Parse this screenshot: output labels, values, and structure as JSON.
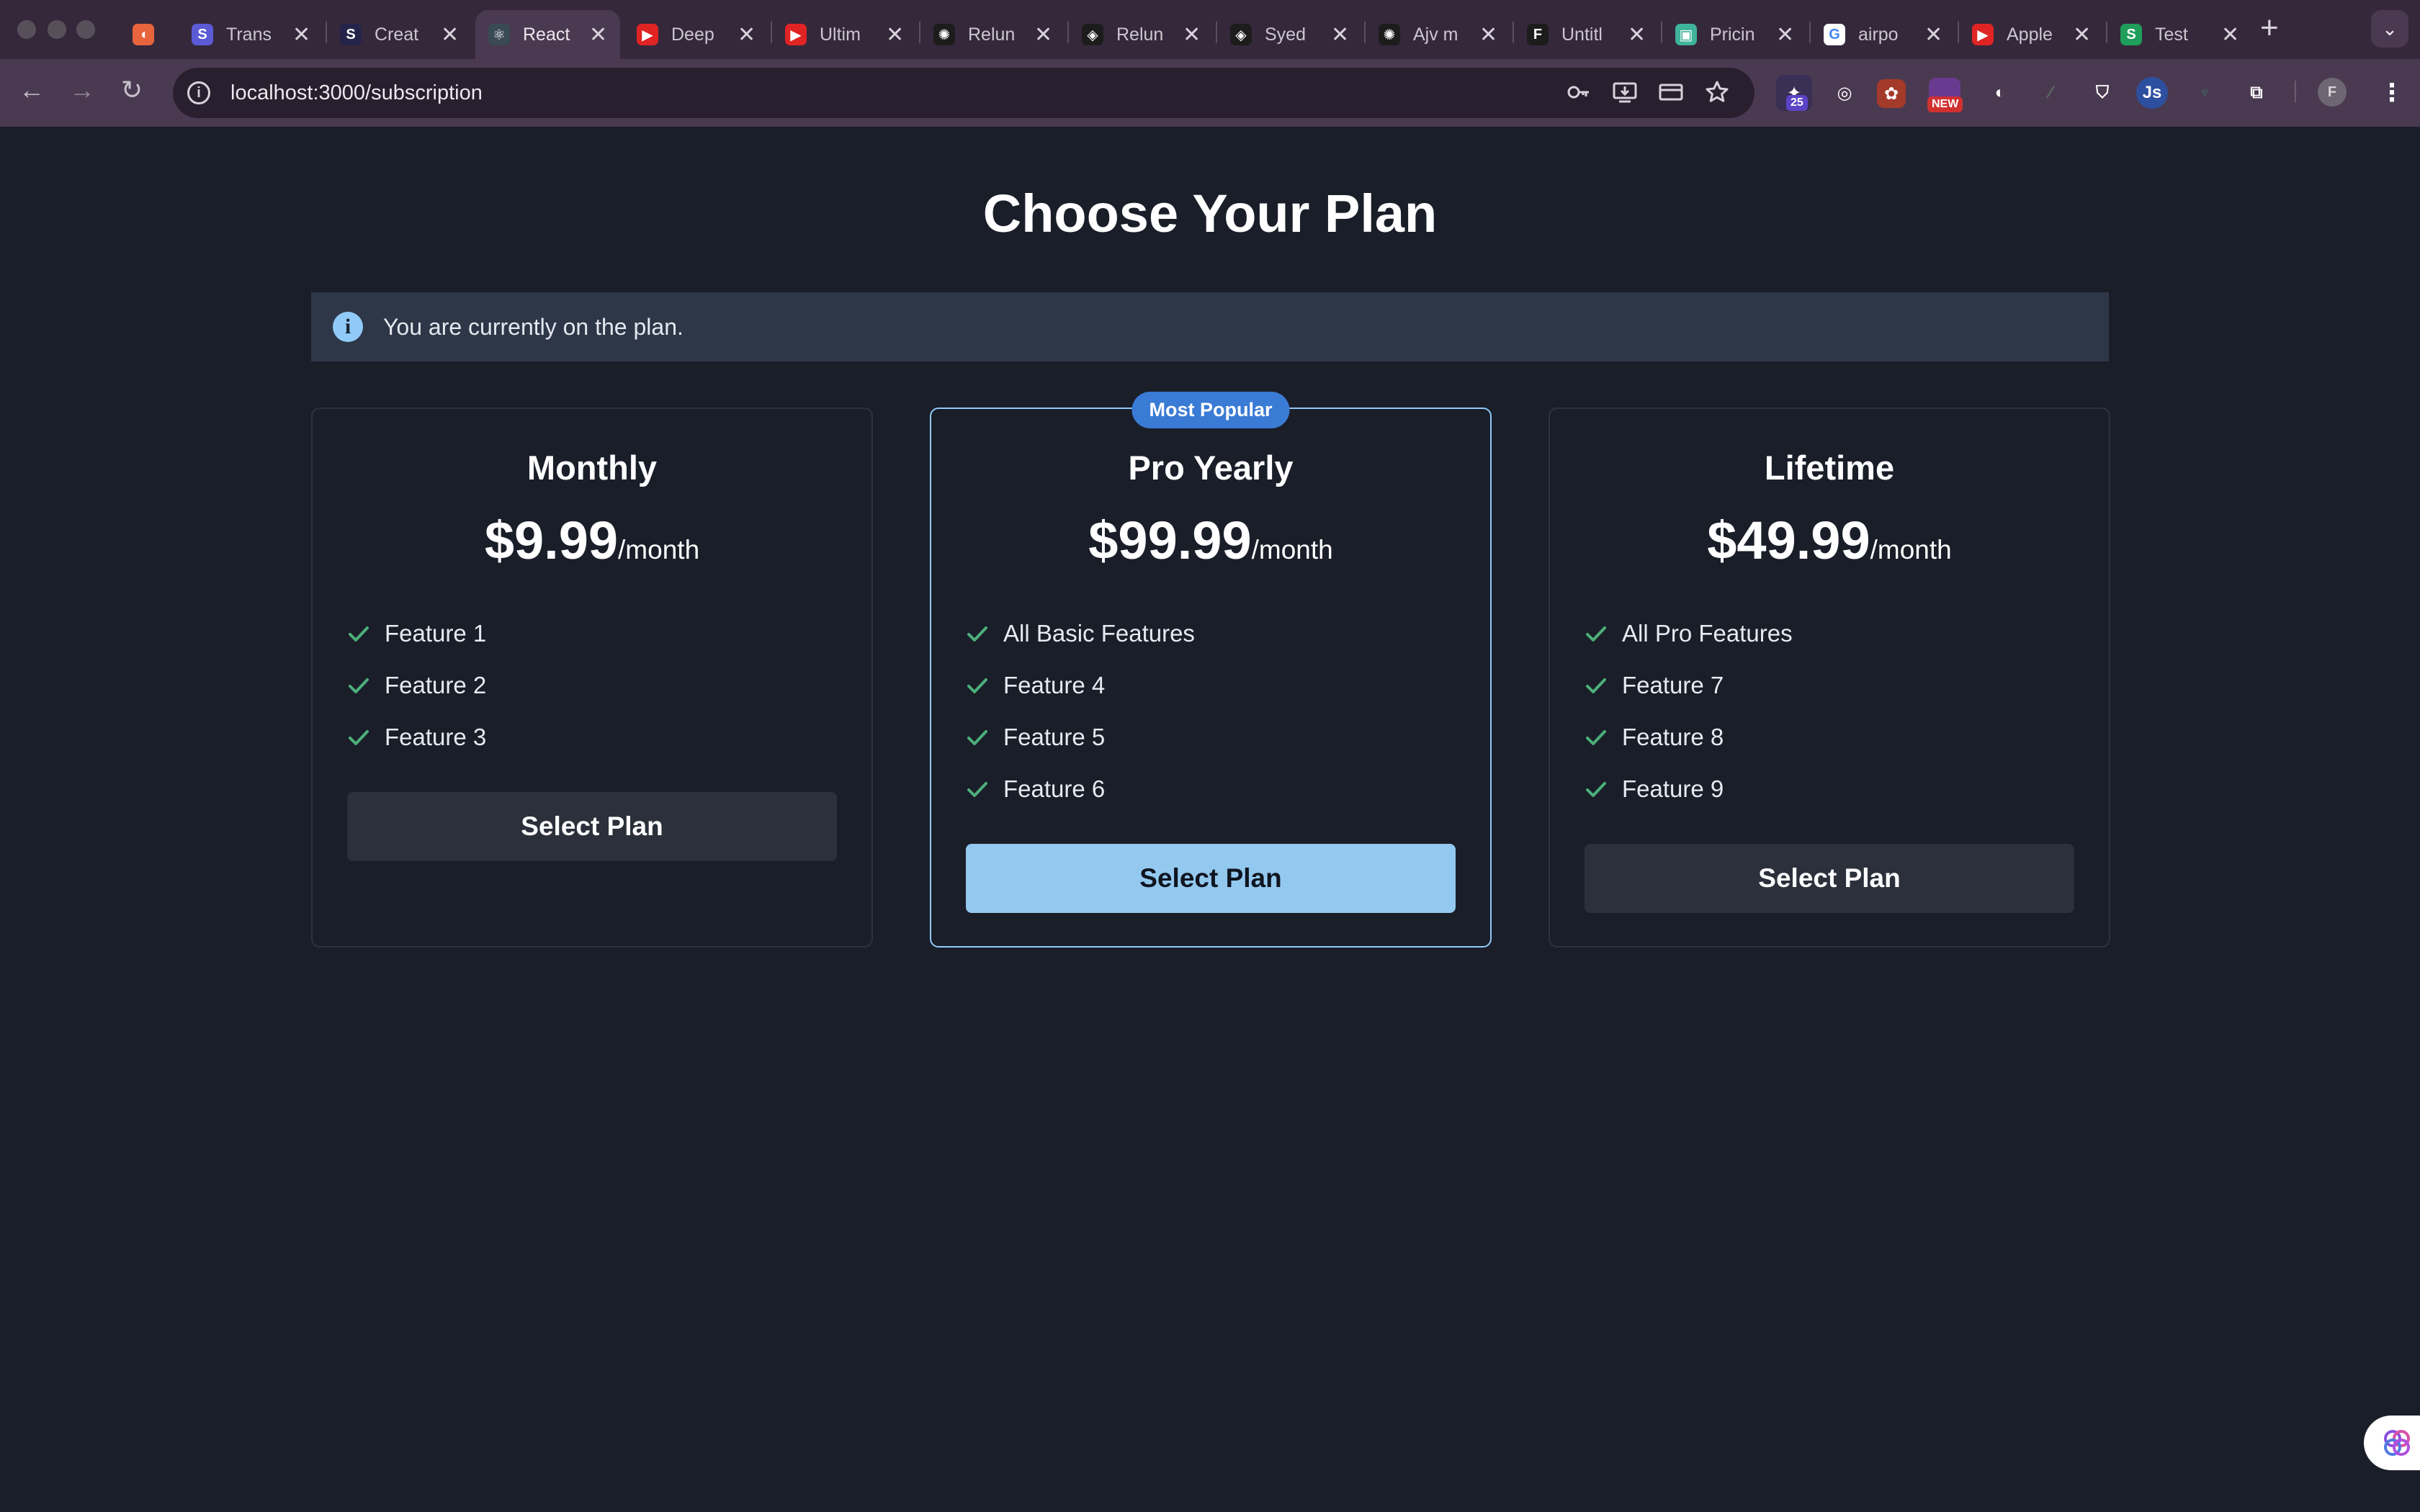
{
  "browser": {
    "tabs": [
      {
        "title": "",
        "favicon_color": "#e8643c",
        "favicon_glyph": "◖"
      },
      {
        "title": "Trans",
        "favicon_color": "#5b5bd6",
        "favicon_glyph": "S"
      },
      {
        "title": "Creat",
        "favicon_color": "#24244a",
        "favicon_glyph": "S"
      },
      {
        "title": "React",
        "favicon_color": "#3a4a55",
        "favicon_glyph": "⚛",
        "active": true
      },
      {
        "title": "Deep",
        "favicon_color": "#e02424",
        "favicon_glyph": "▶"
      },
      {
        "title": "Ultim",
        "favicon_color": "#e02424",
        "favicon_glyph": "▶"
      },
      {
        "title": "Relun",
        "favicon_color": "#1c1c1c",
        "favicon_glyph": "✺"
      },
      {
        "title": "Relun",
        "favicon_color": "#1c1c1c",
        "favicon_glyph": "◈"
      },
      {
        "title": "Syed",
        "favicon_color": "#1c1c1c",
        "favicon_glyph": "◈"
      },
      {
        "title": "Ajv m",
        "favicon_color": "#1c1c1c",
        "favicon_glyph": "✺"
      },
      {
        "title": "Untitl",
        "favicon_color": "#1c1c1c",
        "favicon_glyph": "F"
      },
      {
        "title": "Pricin",
        "favicon_color": "#3fb39b",
        "favicon_glyph": "▣"
      },
      {
        "title": "airpo",
        "favicon_color": "#ffffff",
        "favicon_glyph": "G"
      },
      {
        "title": "Apple",
        "favicon_color": "#e02424",
        "favicon_glyph": "▶"
      },
      {
        "title": "Test",
        "favicon_color": "#1e9e5a",
        "favicon_glyph": "S"
      }
    ],
    "tab_close_glyph": "✕",
    "new_tab_glyph": "+",
    "tab_menu_glyph": "⌄",
    "url": "localhost:3000/subscription",
    "nav": {
      "back": "←",
      "forward": "→",
      "reload": "↻"
    },
    "extension_badges": {
      "count": "25",
      "new": "NEW"
    },
    "extensions": {
      "js_label": "Js",
      "profile_initial": "F"
    }
  },
  "page": {
    "heading": "Choose Your Plan",
    "alert_text": "You are currently on the plan.",
    "plans": [
      {
        "name": "Monthly",
        "price": "$9.99",
        "period": "/month",
        "features": [
          "Feature 1",
          "Feature 2",
          "Feature 3"
        ],
        "button": "Select Plan",
        "popular": false
      },
      {
        "name": "Pro Yearly",
        "price": "$99.99",
        "period": "/month",
        "badge": "Most Popular",
        "features": [
          "All Basic Features",
          "Feature 4",
          "Feature 5",
          "Feature 6"
        ],
        "button": "Select Plan",
        "popular": true
      },
      {
        "name": "Lifetime",
        "price": "$49.99",
        "period": "/month",
        "features": [
          "All Pro Features",
          "Feature 7",
          "Feature 8",
          "Feature 9"
        ],
        "button": "Select Plan",
        "popular": false
      }
    ]
  },
  "colors": {
    "page_bg": "#1a1e29",
    "check": "#4caf7a",
    "accent": "#90caf9",
    "badge": "#3a7bd5"
  }
}
